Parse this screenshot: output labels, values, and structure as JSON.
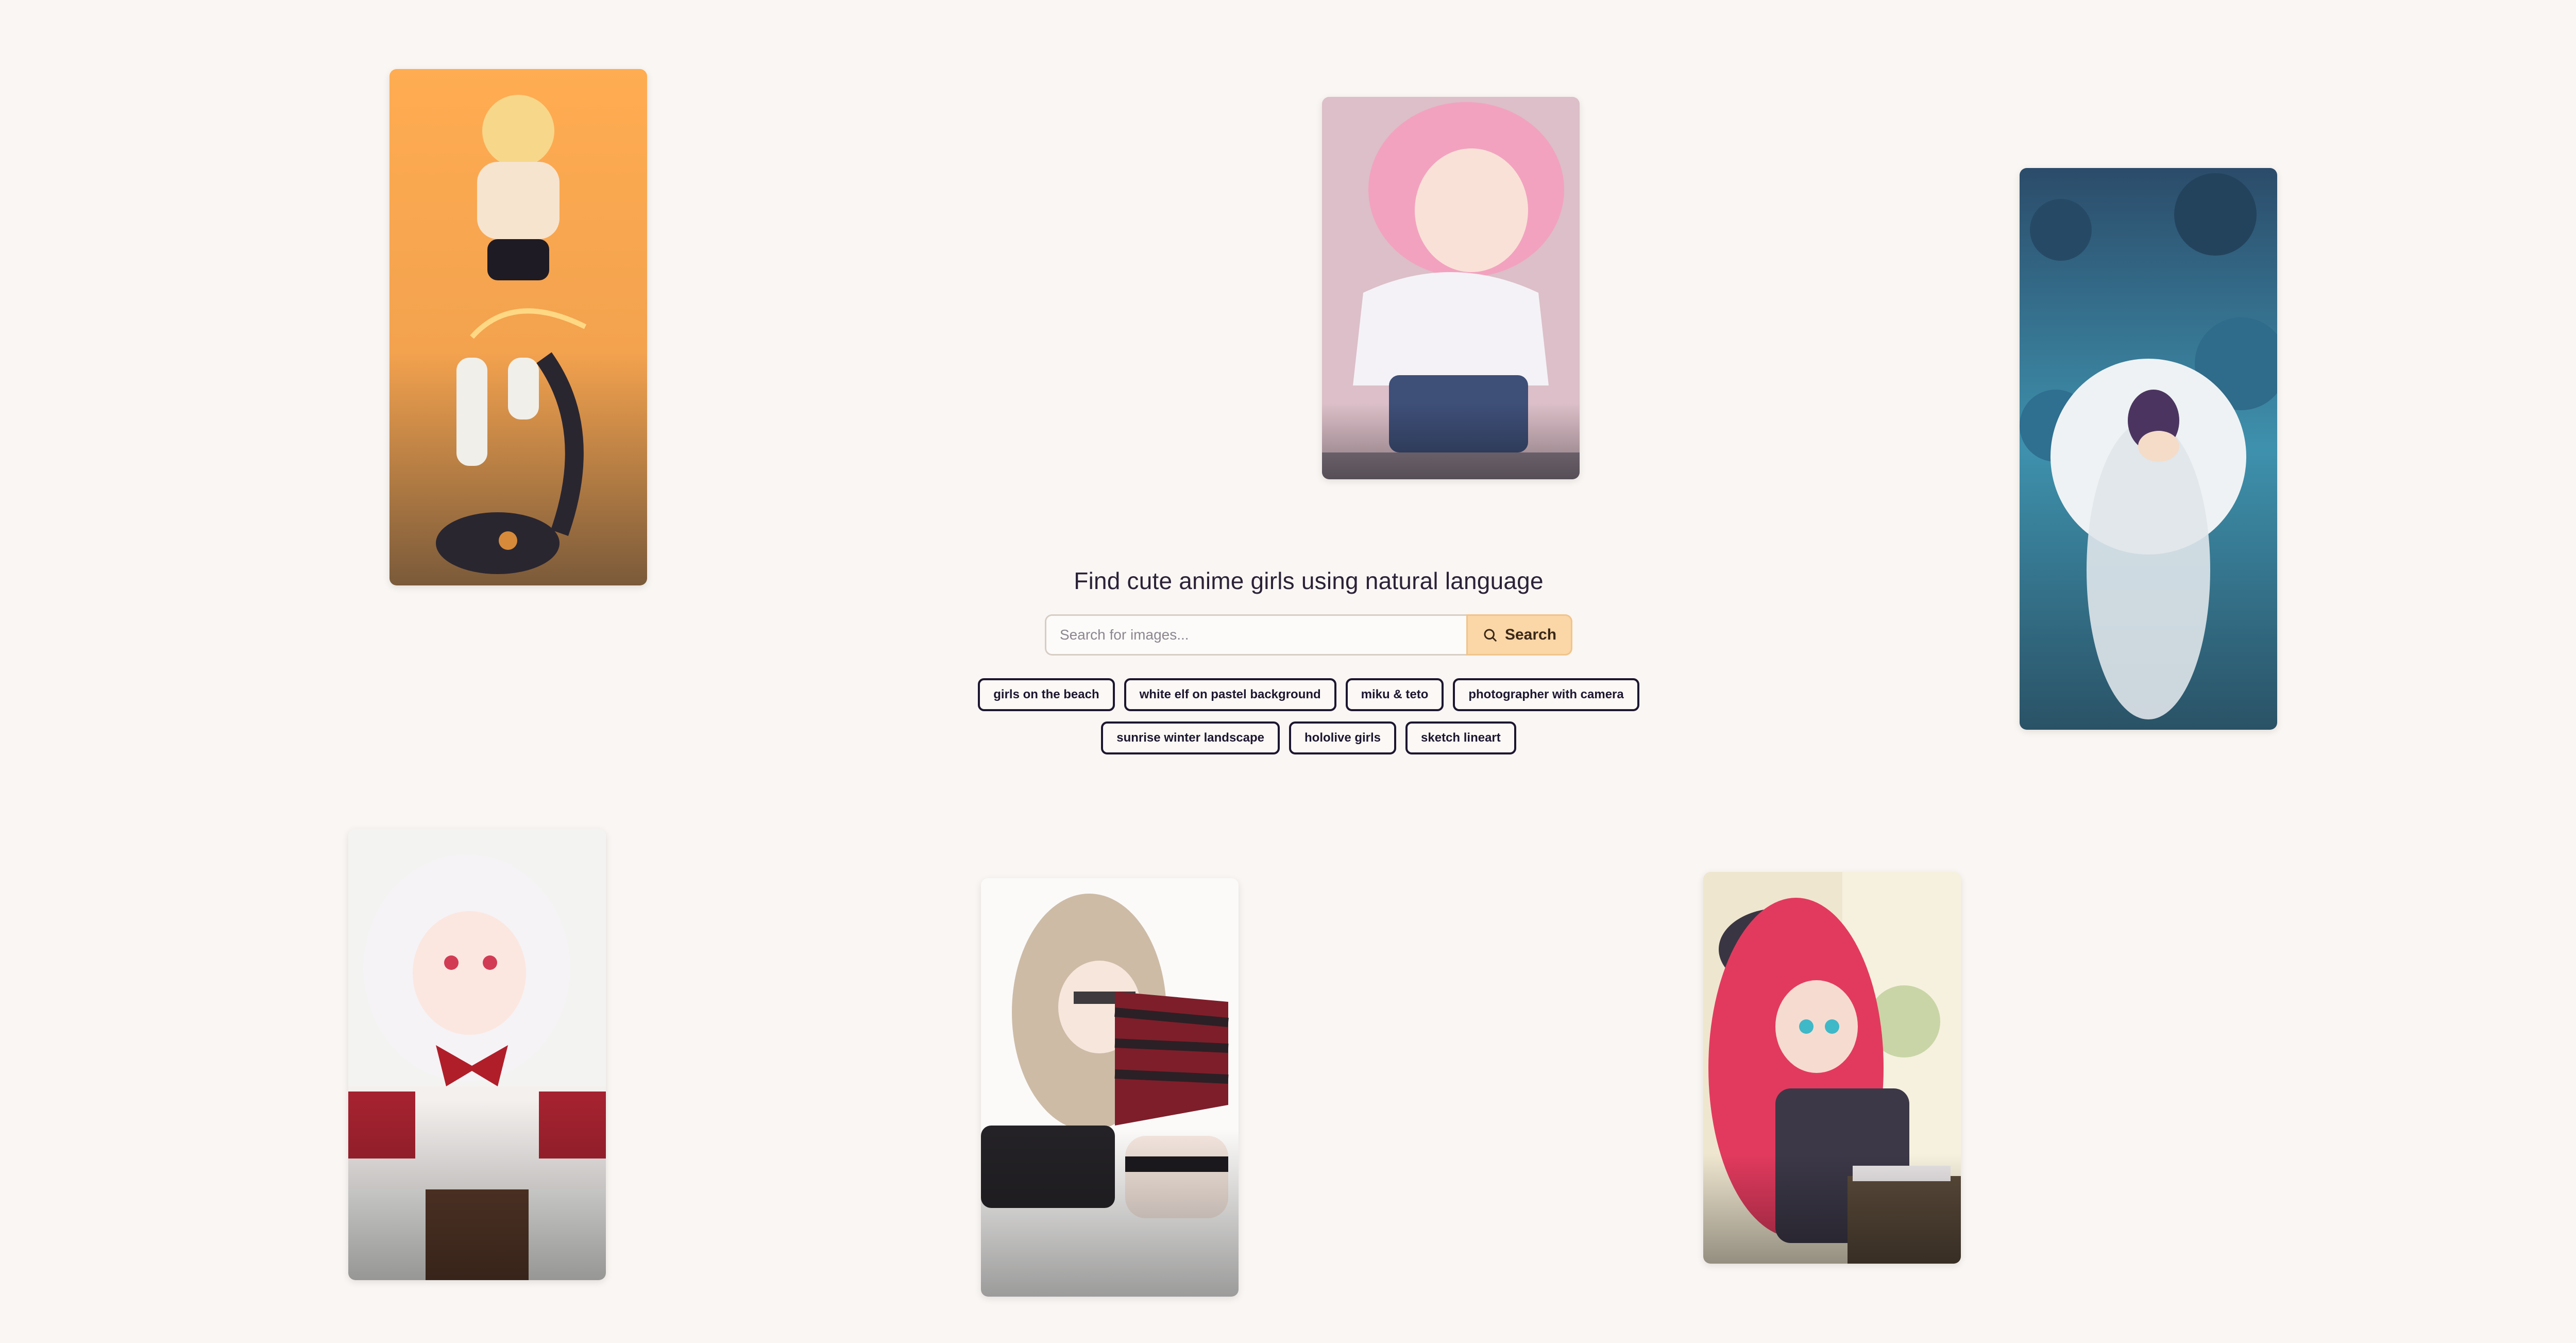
{
  "hero": {
    "title": "Find cute anime girls using natural language"
  },
  "search": {
    "placeholder": "Search for images...",
    "button_label": "Search"
  },
  "suggestions": {
    "row1": [
      "girls on the beach",
      "white elf on pastel background",
      "miku & teto",
      "photographer with camera"
    ],
    "row2": [
      "sunrise winter landscape",
      "hololive girls",
      "sketch lineart"
    ]
  },
  "gallery": [
    {
      "subject": "blonde girl with black devil tail on orange background"
    },
    {
      "subject": "pink haired girl in sailor uniform making peace sign"
    },
    {
      "subject": "sleeping angel girl with halo in blue water"
    },
    {
      "subject": "white haired girl with red bow"
    },
    {
      "subject": "light brown haired girl in red striped sweater"
    },
    {
      "subject": "red haired elf girl with glasses at desk"
    }
  ],
  "colors": {
    "background": "#faf6f3",
    "accent": "#fbd6a6",
    "chip_border": "#1d1630",
    "title": "#2b2238"
  },
  "icons": {
    "search_button": "search-icon"
  }
}
